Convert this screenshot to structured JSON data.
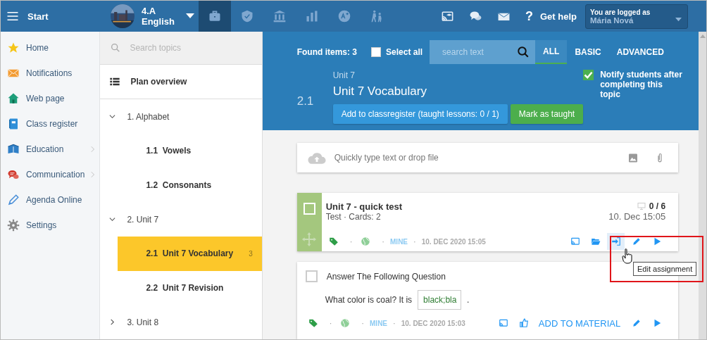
{
  "topbar": {
    "menu_label": "Start",
    "class_name": "4.A",
    "subject": "English",
    "modules": [
      {
        "kind": "briefcase",
        "selected": true
      },
      {
        "kind": "shield",
        "selected": false
      },
      {
        "kind": "bank",
        "selected": false
      },
      {
        "kind": "chart",
        "selected": false
      },
      {
        "kind": "grade",
        "selected": false
      },
      {
        "kind": "people",
        "selected": false
      }
    ],
    "actions": [
      {
        "kind": "cast"
      },
      {
        "kind": "chat"
      },
      {
        "kind": "mail"
      }
    ],
    "help_icon": "?",
    "help_label": "Get help",
    "user_caption": "You are logged as",
    "user_name": "Mária Nová"
  },
  "sidebar": {
    "items": [
      {
        "label": "Home",
        "has_submenu": false
      },
      {
        "label": "Notifications",
        "has_submenu": false
      },
      {
        "label": "Web page",
        "has_submenu": false
      },
      {
        "label": "Class register",
        "has_submenu": false
      },
      {
        "label": "Education",
        "has_submenu": true
      },
      {
        "label": "Communication",
        "has_submenu": true
      },
      {
        "label": "Agenda Online",
        "has_submenu": false
      },
      {
        "label": "Settings",
        "has_submenu": false
      }
    ]
  },
  "topics": {
    "search_placeholder": "Search topics",
    "overview_label": "Plan overview",
    "tree": [
      {
        "number": "1.",
        "label": "Alphabet",
        "expanded": true,
        "children": [
          {
            "number": "1.1",
            "label": "Vowels",
            "selected": false
          },
          {
            "number": "1.2",
            "label": "Consonants",
            "selected": false
          }
        ]
      },
      {
        "number": "2.",
        "label": "Unit 7",
        "expanded": true,
        "children": [
          {
            "number": "2.1",
            "label": "Unit 7 Vocabulary",
            "selected": true,
            "count": "3"
          },
          {
            "number": "2.2",
            "label": "Unit 7 Revision",
            "selected": false
          }
        ]
      },
      {
        "number": "3.",
        "label": "Unit 8",
        "expanded": false
      }
    ]
  },
  "toolbar": {
    "found": "Found items: 3",
    "select_all": {
      "label": "Select all",
      "checked": false
    },
    "search_placeholder": "search text",
    "filters": [
      {
        "label": "ALL",
        "selected": true
      },
      {
        "label": "BASIC",
        "selected": false
      },
      {
        "label": "ADVANCED",
        "selected": false
      }
    ]
  },
  "topic_header": {
    "unit": "Unit 7",
    "number": "2.1",
    "title": "Unit 7 Vocabulary",
    "notify": {
      "label": "Notify students after completing this topic",
      "checked": true
    },
    "add_button": "Add to classregister (taught lessons: 0 / 1)",
    "mark_button": "Mark as taught"
  },
  "quick_input": {
    "placeholder": "Quickly type text or drop file"
  },
  "items": [
    {
      "kind": "test",
      "checked": false,
      "title": "Unit 7 - quick test",
      "subtitle": "Test · Cards: 2",
      "score": "0 / 6",
      "date": "10. Dec 15:05",
      "separators": [
        "·",
        "·",
        "·"
      ],
      "owner": "MINE",
      "created": "10. DEC 2020 15:05",
      "actions": [
        {
          "hovered": false
        },
        {
          "hovered": false
        },
        {
          "hovered": true
        },
        {
          "hovered": false
        },
        {
          "hovered": false
        }
      ],
      "tooltip": "Edit assignment"
    },
    {
      "kind": "question",
      "checked": false,
      "title": "Answer The Following Question",
      "question": "What color is coal? It is",
      "answer": "black;bla",
      "trailing": ".",
      "separators": [
        "·",
        "·",
        "·"
      ],
      "owner": "MINE",
      "created": "10. DEC 2020 15:03",
      "actions": [
        {
          "hovered": false
        },
        {
          "hovered": false
        },
        {
          "hovered": false
        },
        {
          "hovered": false
        }
      ],
      "add_label": "ADD TO MATERIAL"
    }
  ]
}
